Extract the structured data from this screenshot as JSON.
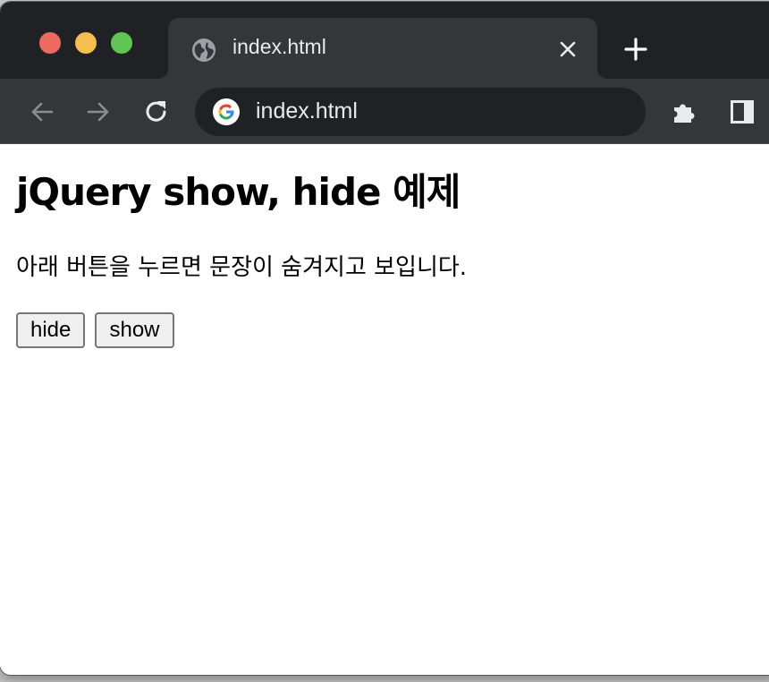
{
  "browser": {
    "tab": {
      "title": "index.html",
      "favicon": "globe-icon"
    },
    "address_bar": {
      "url": "index.html",
      "icon": "google-g-icon"
    },
    "toolbar_icons": [
      "back-arrow-icon",
      "forward-arrow-icon",
      "reload-icon",
      "extensions-puzzle-icon",
      "side-panel-icon"
    ]
  },
  "page": {
    "heading": "jQuery show, hide 예제",
    "description": "아래 버튼을 누르면 문장이 숨겨지고 보입니다.",
    "buttons": {
      "hide_label": "hide",
      "show_label": "show"
    }
  },
  "colors": {
    "titlebar": "#202124",
    "toolbar": "#35363a",
    "traffic_red": "#ec6a5e",
    "traffic_yellow": "#f4bf4f",
    "traffic_green": "#61c554"
  }
}
